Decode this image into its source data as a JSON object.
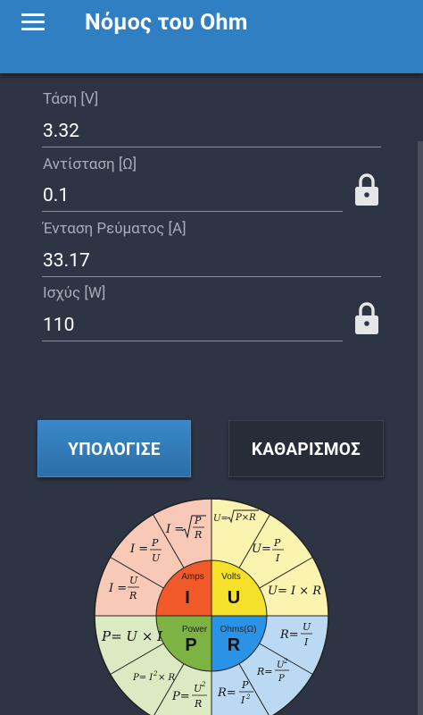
{
  "app": {
    "title": "Νόμος του Ohm",
    "menu_icon": "hamburger-menu-icon"
  },
  "fields": {
    "voltage": {
      "label": "Τάση [V]",
      "value": "3.32"
    },
    "resistance": {
      "label": "Αντίσταση [Ω]",
      "value": "0.1",
      "locked": true
    },
    "current": {
      "label": "Ένταση Ρεύματος [A]",
      "value": "33.17"
    },
    "power": {
      "label": "Ισχύς [W]",
      "value": "110",
      "locked": true
    }
  },
  "buttons": {
    "calculate": "ΥΠΟΛΟΓΙΣΕ",
    "clear": "ΚΑΘΑΡΙΣΜΟΣ"
  },
  "wheel": {
    "center": {
      "amps": {
        "caption": "Amps",
        "letter": "I",
        "color": "#f05a28"
      },
      "volts": {
        "caption": "Volts",
        "letter": "U",
        "color": "#f5e12a"
      },
      "power": {
        "caption": "Power",
        "letter": "P",
        "color": "#7cb342"
      },
      "ohms": {
        "caption": "Ohms(Ω)",
        "letter": "R",
        "color": "#2b93e6"
      }
    },
    "colors": {
      "amps_outer": "#f9c9b8",
      "volts_outer": "#fbf3b0",
      "power_outer": "#dceac3",
      "ohms_outer": "#bcd9f4"
    },
    "formulas": {
      "i_sqrt": "I =",
      "i_pu": "I =",
      "i_ur": "I =",
      "u_sqrt": "U=",
      "u_pi": "U=",
      "u_ir": "U= I × R",
      "r_ui": "R=",
      "r_u2p": "R=",
      "r_pi2": "R=",
      "p_u2r": "P=",
      "p_i2r": "P= I",
      "p_ui": "P= U × I"
    }
  }
}
